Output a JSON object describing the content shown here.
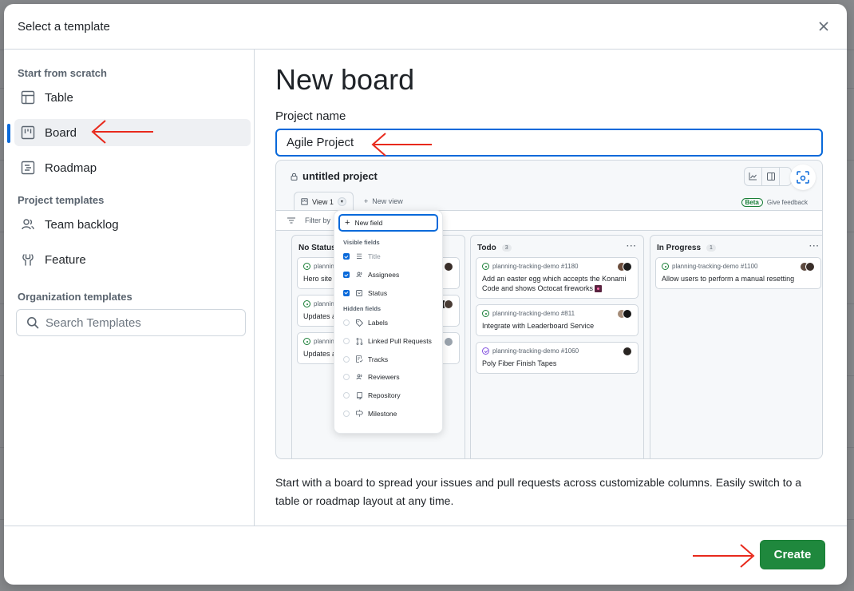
{
  "dialog": {
    "title": "Select a template",
    "close_icon": "x-icon"
  },
  "sidebar": {
    "sections": [
      {
        "title": "Start from scratch",
        "items": [
          {
            "label": "Table",
            "icon": "table-icon",
            "active": false
          },
          {
            "label": "Board",
            "icon": "project-board-icon",
            "active": true
          },
          {
            "label": "Roadmap",
            "icon": "roadmap-icon",
            "active": false
          }
        ]
      },
      {
        "title": "Project templates",
        "items": [
          {
            "label": "Team backlog",
            "icon": "people-icon",
            "active": false
          },
          {
            "label": "Feature",
            "icon": "feature-icon",
            "active": false
          }
        ]
      },
      {
        "title": "Organization templates",
        "items": []
      }
    ],
    "search": {
      "placeholder": "Search Templates",
      "value": "",
      "icon": "search-icon"
    }
  },
  "main": {
    "title": "New board",
    "project_name_label": "Project name",
    "project_name_value": "Agile Project",
    "description": "Start with a board to spread your issues and pull requests across customizable columns. Easily switch to a table or roadmap layout at any time."
  },
  "preview": {
    "project_title": "untitled project",
    "view_tab": "View 1",
    "new_view": "New view",
    "beta_badge": "Beta",
    "give_feedback": "Give feedback",
    "filter_text": "Filter by",
    "columns": [
      {
        "name": "No Status",
        "count": "",
        "cards": [
          {
            "repo": "planning-tracking-demo",
            "title": "Hero site",
            "state": "open"
          },
          {
            "repo": "planning-tracking-demo",
            "title": "Updates a",
            "state": "open"
          },
          {
            "repo": "planning-tracking-demo",
            "title": "Updates a",
            "state": "open"
          }
        ]
      },
      {
        "name": "Todo",
        "count": "3",
        "cards": [
          {
            "repo": "planning-tracking-demo #1180",
            "title": "Add an easter egg which accepts the Konami Code and shows Octocat fireworks",
            "state": "open"
          },
          {
            "repo": "planning-tracking-demo #811",
            "title": "Integrate with Leaderboard Service",
            "state": "open"
          },
          {
            "repo": "planning-tracking-demo #1060",
            "title": "Poly Fiber Finish Tapes",
            "state": "done"
          }
        ]
      },
      {
        "name": "In Progress",
        "count": "1",
        "cards": [
          {
            "repo": "planning-tracking-demo #1100",
            "title": "Allow users to perform a manual resetting",
            "state": "open"
          }
        ]
      }
    ],
    "field_menu": {
      "new_field": "New field",
      "visible_title": "Visible fields",
      "visible": [
        {
          "label": "Title",
          "checked": true,
          "icon": "list-icon"
        },
        {
          "label": "Assignees",
          "checked": true,
          "icon": "people-icon"
        },
        {
          "label": "Status",
          "checked": true,
          "icon": "single-select-icon"
        }
      ],
      "hidden_title": "Hidden fields",
      "hidden": [
        {
          "label": "Labels",
          "checked": false,
          "icon": "tag-icon"
        },
        {
          "label": "Linked Pull Requests",
          "checked": false,
          "icon": "git-pull-request-icon"
        },
        {
          "label": "Tracks",
          "checked": false,
          "icon": "tracks-icon"
        },
        {
          "label": "Reviewers",
          "checked": false,
          "icon": "people-icon"
        },
        {
          "label": "Repository",
          "checked": false,
          "icon": "repo-icon"
        },
        {
          "label": "Milestone",
          "checked": false,
          "icon": "milestone-icon"
        }
      ]
    }
  },
  "footer": {
    "create_label": "Create"
  },
  "colors": {
    "accent": "#0969da",
    "primary_button": "#1f883d",
    "annotation_arrow": "#e8291c"
  }
}
